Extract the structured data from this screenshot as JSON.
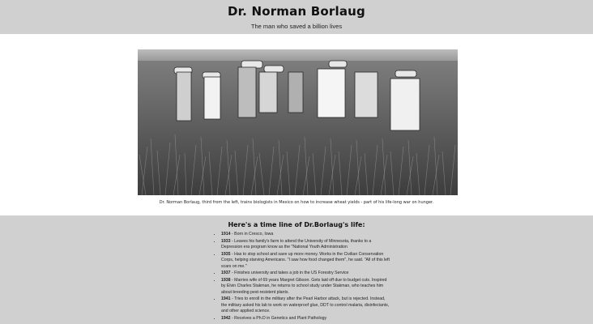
{
  "header": {
    "title": "Dr. Norman Borlaug",
    "subtitle": "The man who saved a billion lives"
  },
  "photo": {
    "caption": "Dr. Norman Borlaug, third from the left, trains biologists in Mexico on how to increase wheat yields - part of his life-long war on hunger."
  },
  "timeline": {
    "heading": "Here's a time line of Dr.Borlaug's life:",
    "items": [
      {
        "year": "1914",
        "text": " - Born in Cresco, Iowa"
      },
      {
        "year": "1933",
        "text": " - Leaves his family's farm to attend the University of Minnesota, thanks to a Depression era program know as the \"National Youth Administration"
      },
      {
        "year": "1935",
        "text": " - Has to stop school and save up more money. Works in the Civilian Conservation Corps, helping starving Americans. \"I saw how food changed them\", he said. \"All of this left scars on me.\""
      },
      {
        "year": "1937",
        "text": " - Finishes university and takes a job in the US Forestry Service"
      },
      {
        "year": "1938",
        "text": " - Marries wife of 69 years Margret Gibson. Gets laid off due to budget cuts. Inspired by Elvin Charles Stakman, he returns to school study under Stakman, who teaches him about breeding pest-resistent plants."
      },
      {
        "year": "1941",
        "text": " - Tries to enroll in the military after the Pearl Harbor attack, but is rejected. Instead, the military asked his lab to work on waterproof glue, DDT to control malaria, disinfectants, and other applied science."
      },
      {
        "year": "1942",
        "text": " - Receives a Ph.D in Genetics and Plant Pathology"
      }
    ]
  }
}
